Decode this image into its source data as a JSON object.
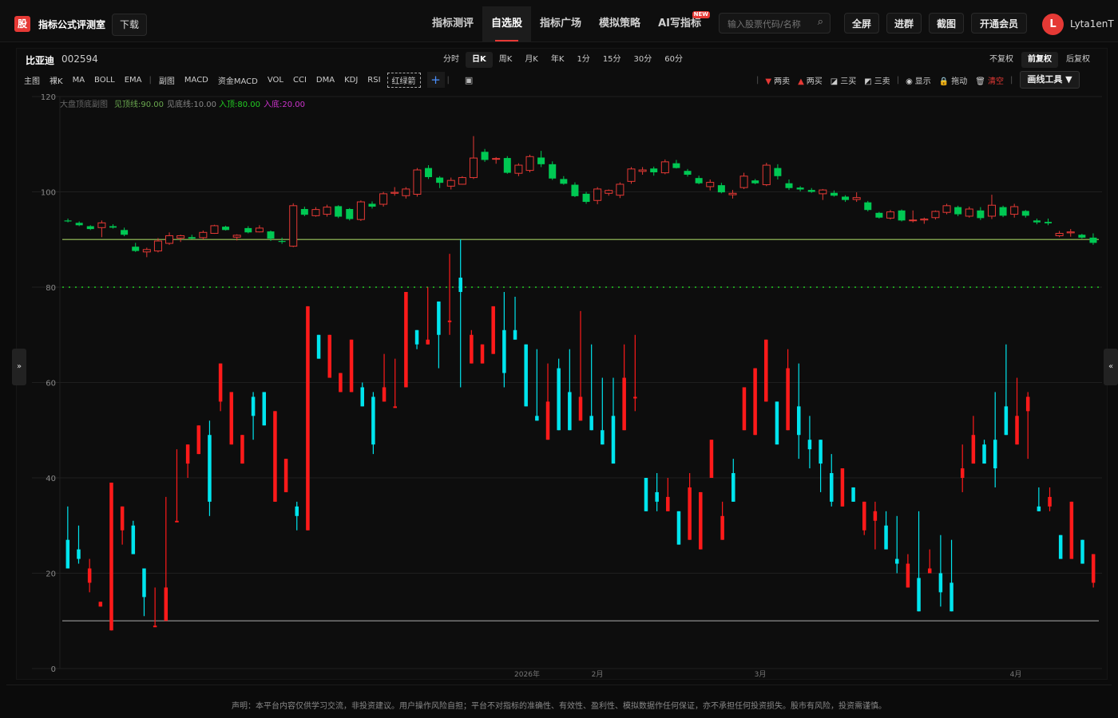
{
  "header": {
    "logo_char": "股",
    "title": "指标公式评测室",
    "download": "下载",
    "nav": [
      {
        "label": "指标测评",
        "active": false,
        "badge": ""
      },
      {
        "label": "自选股",
        "active": true,
        "badge": ""
      },
      {
        "label": "指标广场",
        "active": false,
        "badge": ""
      },
      {
        "label": "模拟策略",
        "active": false,
        "badge": ""
      },
      {
        "label": "AI写指标",
        "active": false,
        "badge": "NEW"
      }
    ],
    "search_placeholder": "输入股票代码/名称",
    "buttons": {
      "fullscreen": "全屏",
      "join": "进群",
      "screenshot": "截图",
      "vip": "开通会员"
    },
    "avatar_letter": "L",
    "username": "Lyta1enT"
  },
  "stock": {
    "name": "比亚迪",
    "code": "002594"
  },
  "periods": [
    "分时",
    "日K",
    "周K",
    "月K",
    "年K",
    "1分",
    "15分",
    "30分",
    "60分"
  ],
  "active_period": "日K",
  "adjust": [
    "不复权",
    "前复权",
    "后复权"
  ],
  "active_adjust": "前复权",
  "indicators": {
    "main": [
      "主图",
      "裸K",
      "MA",
      "BOLL",
      "EMA"
    ],
    "sub": [
      "副图",
      "MACD",
      "资金MACD",
      "VOL",
      "CCI",
      "DMA",
      "KDJ",
      "RSI",
      "红绿箭"
    ]
  },
  "draw_tools": {
    "items": [
      {
        "label": "两卖",
        "glyph": "▼",
        "color": "#e53935"
      },
      {
        "label": "两买",
        "glyph": "▲",
        "color": "#e53935"
      },
      {
        "label": "三买",
        "glyph": "◪",
        "color": "#dddddd"
      },
      {
        "label": "三卖",
        "glyph": "◩",
        "color": "#dddddd"
      },
      {
        "label": "显示",
        "glyph": "◉",
        "color": "#dddddd"
      },
      {
        "label": "拖动",
        "glyph": "🔒",
        "color": "#f0c040"
      },
      {
        "label": "清空",
        "glyph": "🗑",
        "color": "#e53935"
      }
    ],
    "button": "画线工具 ▼"
  },
  "legend": {
    "name": "大盘顶底副图",
    "items": [
      {
        "label": "见顶线:90.00",
        "color": "#6aa84f"
      },
      {
        "label": "见底线:10.00",
        "color": "#888888"
      },
      {
        "label": "入顶:80.00",
        "color": "#22cc22"
      },
      {
        "label": "入底:20.00",
        "color": "#cc33cc"
      }
    ]
  },
  "side_left": "»",
  "side_right": "«",
  "chart_data": {
    "type": "candlestick",
    "y_axis": {
      "min": 0,
      "max": 120,
      "ticks": [
        0,
        20,
        40,
        60,
        80,
        100,
        120
      ]
    },
    "x_labels": [
      "2026年",
      "2月",
      "3月",
      "4月"
    ],
    "colors": {
      "up": "#e53935",
      "down": "#00c853",
      "sub_up": "#ff1a1a",
      "sub_down": "#00e5ee"
    },
    "price_candles": [
      [
        94,
        94.4,
        93.6,
        93.8
      ],
      [
        93.5,
        93.8,
        92.8,
        93
      ],
      [
        92.8,
        93,
        92,
        92.2
      ],
      [
        92.5,
        94,
        90.5,
        93.5
      ],
      [
        92.8,
        93.2,
        92.3,
        92.5
      ],
      [
        92,
        92.5,
        90.7,
        91
      ],
      [
        88.5,
        89.3,
        87.4,
        87.6
      ],
      [
        87.4,
        88.3,
        86.3,
        87.9
      ],
      [
        87.6,
        90.3,
        87.3,
        89.7
      ],
      [
        89.2,
        91.5,
        88.9,
        90.8
      ],
      [
        90.3,
        91,
        89.5,
        90.8
      ],
      [
        90.5,
        91,
        90.1,
        90.2
      ],
      [
        90.4,
        91.9,
        90,
        91.5
      ],
      [
        91.3,
        93.1,
        91.2,
        92.9
      ],
      [
        92.7,
        92.9,
        91.9,
        92
      ],
      [
        90.5,
        91.1,
        89.8,
        90.9
      ],
      [
        92.4,
        92.8,
        91.3,
        91.5
      ],
      [
        91.6,
        93,
        91.5,
        92.4
      ],
      [
        91.7,
        91.9,
        89.7,
        90.2
      ],
      [
        89.7,
        90.4,
        89.1,
        89.5
      ],
      [
        88.6,
        97.6,
        88.4,
        97.1
      ],
      [
        96.4,
        96.9,
        94.9,
        95.2
      ],
      [
        95,
        96.8,
        94.8,
        96.3
      ],
      [
        95.3,
        97.3,
        94.8,
        96.8
      ],
      [
        97,
        97.2,
        94.5,
        94.8
      ],
      [
        96.4,
        96.6,
        94,
        94.3
      ],
      [
        94.2,
        98.2,
        93.9,
        97.9
      ],
      [
        97.5,
        98,
        96.5,
        96.9
      ],
      [
        97.4,
        100,
        96.9,
        99.6
      ],
      [
        99.7,
        101,
        99.2,
        99.9
      ],
      [
        99.2,
        101,
        98.6,
        100.6
      ],
      [
        99.5,
        105,
        99,
        104.6
      ],
      [
        105,
        105.6,
        102.7,
        103.1
      ],
      [
        103,
        103.3,
        100.8,
        101.9
      ],
      [
        101.2,
        103,
        100.5,
        102.4
      ],
      [
        101.6,
        103.3,
        101.5,
        103
      ],
      [
        103,
        111.7,
        102.7,
        107.1
      ],
      [
        108.4,
        109,
        106.3,
        106.7
      ],
      [
        106.9,
        107.3,
        105.9,
        107
      ],
      [
        107.1,
        107.5,
        103.8,
        104
      ],
      [
        103.9,
        106,
        103.3,
        105.6
      ],
      [
        104.5,
        107.8,
        104.1,
        107.4
      ],
      [
        107.2,
        108.6,
        105.2,
        105.8
      ],
      [
        105.8,
        106.4,
        102.5,
        102.8
      ],
      [
        102.7,
        103.3,
        101.5,
        101.7
      ],
      [
        101.5,
        102,
        98.9,
        99.1
      ],
      [
        99.6,
        100,
        97.5,
        97.9
      ],
      [
        98.2,
        101,
        97.4,
        100.6
      ],
      [
        99.7,
        100.5,
        99.2,
        100.3
      ],
      [
        99.3,
        102,
        98.7,
        101.6
      ],
      [
        102.2,
        105.2,
        101.7,
        104.8
      ],
      [
        104.3,
        105.2,
        103.6,
        104.6
      ],
      [
        104.9,
        105.3,
        103.4,
        104.1
      ],
      [
        104,
        106.8,
        103.7,
        106.3
      ],
      [
        106,
        106.7,
        104.9,
        105
      ],
      [
        104.4,
        104.8,
        103.2,
        103.6
      ],
      [
        102.9,
        103.4,
        101.6,
        101.8
      ],
      [
        101.1,
        102.6,
        100.3,
        102
      ],
      [
        101.4,
        101.9,
        99.7,
        99.9
      ],
      [
        99.4,
        100.4,
        98.6,
        99.7
      ],
      [
        100.9,
        104,
        100.6,
        103.3
      ],
      [
        102.4,
        102.7,
        101.6,
        101.8
      ],
      [
        101.5,
        106.1,
        101.2,
        105.6
      ],
      [
        105,
        105.8,
        102.6,
        103.3
      ],
      [
        101.8,
        102.6,
        100.4,
        100.8
      ],
      [
        100.9,
        101.2,
        100.1,
        100.5
      ],
      [
        100.4,
        100.8,
        99.8,
        100
      ],
      [
        99.6,
        100.6,
        98.3,
        100.4
      ],
      [
        99.8,
        100.3,
        99,
        99.2
      ],
      [
        99,
        99.3,
        97.9,
        98.3
      ],
      [
        98.4,
        99.9,
        97.9,
        98.8
      ],
      [
        97.8,
        98.1,
        95.9,
        96.2
      ],
      [
        95.6,
        95.8,
        94.4,
        94.6
      ],
      [
        94.5,
        96.2,
        94.2,
        95.8
      ],
      [
        96.1,
        96.3,
        93.8,
        94
      ],
      [
        94,
        96.1,
        93.6,
        94.1
      ],
      [
        94.1,
        94.6,
        93.3,
        94.3
      ],
      [
        94.6,
        96.1,
        94.2,
        95.9
      ],
      [
        95.7,
        97.5,
        95.3,
        97.1
      ],
      [
        96.8,
        97.1,
        94.9,
        95.3
      ],
      [
        94.9,
        96.9,
        94.6,
        96.4
      ],
      [
        96.1,
        96.8,
        94.1,
        94.5
      ],
      [
        94.9,
        99.4,
        94.3,
        97.2
      ],
      [
        96.8,
        97.1,
        94.7,
        95
      ],
      [
        95.3,
        97.5,
        94.6,
        96.9
      ],
      [
        96,
        96.2,
        94.6,
        95
      ],
      [
        94,
        94.4,
        93.2,
        93.6
      ],
      [
        93.7,
        94.4,
        93,
        93.4
      ],
      [
        90.8,
        91.8,
        90.5,
        91.3
      ],
      [
        91.4,
        92.2,
        90.6,
        91.6
      ],
      [
        91,
        91.2,
        90.2,
        90.4
      ],
      [
        90.4,
        91.3,
        88.9,
        89.3
      ]
    ],
    "indicator_bars": [
      [
        27,
        22,
        34,
        21
      ],
      [
        25,
        22,
        30,
        23
      ],
      [
        18,
        16,
        23,
        21
      ],
      [
        13,
        13,
        14,
        14
      ],
      [
        8,
        39,
        8,
        39
      ],
      [
        29,
        26,
        34,
        34
      ],
      [
        30,
        24,
        31,
        24
      ],
      [
        21,
        11,
        16,
        15
      ],
      [
        9,
        13,
        17,
        9
      ],
      [
        10,
        36,
        20,
        17
      ],
      [
        31,
        42,
        46,
        31
      ],
      [
        43,
        40,
        45,
        47
      ],
      [
        45,
        51,
        46,
        51
      ],
      [
        49,
        32,
        52,
        35
      ],
      [
        56,
        54,
        62,
        64
      ],
      [
        47,
        52,
        54,
        58
      ],
      [
        43,
        46,
        48,
        49
      ],
      [
        57,
        48,
        58,
        53
      ],
      [
        58,
        51,
        58,
        51
      ],
      [
        35,
        53,
        40,
        54
      ],
      [
        37,
        41,
        40,
        44
      ],
      [
        34,
        29,
        35,
        32
      ],
      [
        29,
        76,
        29,
        76
      ],
      [
        70,
        65,
        70,
        65
      ],
      [
        61,
        68,
        66,
        70
      ],
      [
        58,
        62,
        58,
        62
      ],
      [
        58,
        64,
        61,
        69
      ],
      [
        59,
        57,
        60,
        55
      ],
      [
        57,
        45,
        58,
        47
      ],
      [
        56,
        58,
        66,
        59
      ],
      [
        55,
        62,
        65,
        55
      ],
      [
        59,
        73,
        63,
        79
      ],
      [
        71,
        67,
        69,
        68
      ],
      [
        68,
        72,
        80,
        69
      ],
      [
        77,
        63,
        77,
        70
      ],
      [
        73,
        70,
        87,
        73
      ],
      [
        82,
        59,
        90,
        79
      ],
      [
        64,
        71,
        69,
        70
      ],
      [
        64,
        68,
        66,
        68
      ],
      [
        66,
        70,
        72,
        76
      ],
      [
        71,
        59,
        79,
        62
      ],
      [
        71,
        70,
        78,
        69
      ],
      [
        68,
        56,
        68,
        55
      ],
      [
        53,
        58,
        67,
        52
      ],
      [
        48,
        53,
        64,
        56
      ],
      [
        63,
        56,
        65,
        50
      ],
      [
        58,
        53,
        67,
        50
      ],
      [
        52,
        60,
        75,
        57
      ],
      [
        53,
        51,
        68,
        50
      ],
      [
        50,
        61,
        60,
        47
      ],
      [
        53,
        60,
        61,
        43
      ],
      [
        50,
        63,
        68,
        61
      ],
      [
        57,
        54,
        70,
        57
      ],
      [
        40,
        35,
        39,
        33
      ],
      [
        37,
        33,
        41,
        35
      ],
      [
        33,
        36,
        40,
        36
      ],
      [
        33,
        28,
        28,
        26
      ],
      [
        27,
        41,
        30,
        38
      ],
      [
        25,
        35,
        33,
        37
      ],
      [
        40,
        47,
        45,
        48
      ],
      [
        27,
        35,
        30,
        32
      ],
      [
        41,
        44,
        40,
        35
      ],
      [
        50,
        56,
        54,
        59
      ],
      [
        49,
        57,
        55,
        63
      ],
      [
        56,
        66,
        62,
        69
      ],
      [
        56,
        48,
        55,
        47
      ],
      [
        50,
        67,
        54,
        63
      ],
      [
        55,
        44,
        64,
        49
      ],
      [
        48,
        42,
        53,
        46
      ],
      [
        48,
        37,
        47,
        43
      ],
      [
        41,
        34,
        45,
        35
      ],
      [
        34,
        41,
        37,
        42
      ],
      [
        38,
        38,
        38,
        35
      ],
      [
        29,
        34,
        28,
        35
      ],
      [
        31,
        25,
        35,
        33
      ],
      [
        30,
        26,
        33,
        25
      ],
      [
        23,
        32,
        20,
        22
      ],
      [
        17,
        24,
        19,
        22
      ],
      [
        19,
        14,
        33,
        12
      ],
      [
        20,
        25,
        23,
        21
      ],
      [
        20,
        28,
        13,
        16
      ],
      [
        18,
        27,
        17,
        12
      ],
      [
        40,
        47,
        37,
        42
      ],
      [
        43,
        53,
        46,
        49
      ],
      [
        47,
        48,
        46,
        43
      ],
      [
        48,
        38,
        58,
        42
      ],
      [
        55,
        65,
        68,
        49
      ],
      [
        47,
        61,
        59,
        53
      ],
      [
        54,
        44,
        58,
        57
      ],
      [
        34,
        38,
        38,
        33
      ],
      [
        34,
        33,
        38,
        36
      ],
      [
        28,
        23,
        28,
        23
      ],
      [
        23,
        34,
        24,
        35
      ],
      [
        27,
        26,
        22,
        22
      ],
      [
        18,
        23,
        17,
        24
      ]
    ]
  },
  "disclaimer": "声明：本平台内容仅供学习交流，非投资建议。用户操作风险自担；平台不对指标的准确性、有效性、盈利性、模拟数据作任何保证，亦不承担任何投资损失。股市有风险，投资需谨慎。"
}
